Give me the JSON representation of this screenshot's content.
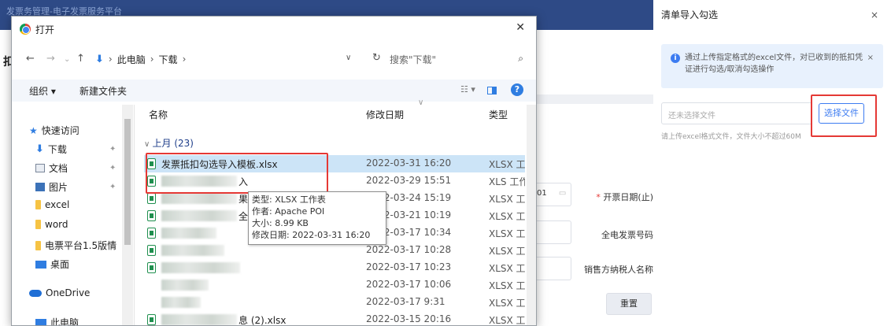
{
  "background": {
    "header_text": "发票务管理-电子发票服务平台",
    "page_title": "扣",
    "field_date_suffix": "01",
    "labels": {
      "invoice_date_end": "开票日期(止)",
      "invoice_number": "全电发票号码",
      "seller_name": "销售方纳税人名称"
    },
    "reset_label": "重置"
  },
  "drawer": {
    "title": "清单导入勾选",
    "close": "×",
    "notice": "通过上传指定格式的excel文件，对已收到的抵扣凭证进行勾选/取消勾选操作",
    "file_placeholder": "还未选择文件",
    "choose_file_label": "选择文件",
    "hint": "请上传excel格式文件，文件大小不超过60M"
  },
  "dialog": {
    "title": "打开",
    "close": "✕",
    "breadcrumb": [
      "此电脑",
      "下载"
    ],
    "search_placeholder": "搜索\"下载\"",
    "toolbar": {
      "organize": "组织 ▾",
      "new_folder": "新建文件夹"
    },
    "nav": [
      {
        "label": "快速访问",
        "icon": "star-icon"
      },
      {
        "label": "下载",
        "icon": "download-icon",
        "pinned": true
      },
      {
        "label": "文档",
        "icon": "documents-icon",
        "pinned": true
      },
      {
        "label": "图片",
        "icon": "pictures-icon",
        "pinned": true
      },
      {
        "label": "excel",
        "icon": "folder-icon"
      },
      {
        "label": "word",
        "icon": "folder-icon"
      },
      {
        "label": "电票平台1.5版情",
        "icon": "folder-icon"
      },
      {
        "label": "桌面",
        "icon": "desktop-icon"
      },
      {
        "label": "OneDrive",
        "icon": "onedrive-icon"
      },
      {
        "label": "此电脑",
        "icon": "computer-icon"
      }
    ],
    "columns": {
      "name": "名称",
      "date": "修改日期",
      "type": "类型"
    },
    "group_label": "上月 (23)",
    "files": [
      {
        "name": "发票抵扣勾选导入模板.xlsx",
        "date": "2022-03-31 16:20",
        "type": "XLSX 工作表",
        "selected": true
      },
      {
        "name": "入",
        "date": "2022-03-29 15:51",
        "type": "XLS 工作表"
      },
      {
        "name": "果",
        "date": "2022-03-24 15:19",
        "type": "XLSX 工作表"
      },
      {
        "name": "全",
        "date": "2022-03-21 10:19",
        "type": "XLSX 工作表"
      },
      {
        "name": "",
        "date": "2022-03-17 10:34",
        "type": "XLSX 工作表"
      },
      {
        "name": "",
        "date": "2022-03-17 10:28",
        "type": "XLSX 工作表"
      },
      {
        "name": "",
        "date": "2022-03-17 10:23",
        "type": "XLSX 工作表"
      },
      {
        "name": "",
        "date": "2022-03-17 10:06",
        "type": "XLSX 工作表"
      },
      {
        "name": "",
        "date": "2022-03-17 9:31",
        "type": "XLSX 工作表"
      },
      {
        "name": "息 (2).xlsx",
        "date": "2022-03-15 20:16",
        "type": "XLSX 工作表"
      }
    ],
    "tooltip": {
      "type": "类型: XLSX 工作表",
      "author": "作者: Apache POI",
      "size": "大小: 8.99 KB",
      "modified": "修改日期: 2022-03-31 16:20"
    }
  }
}
